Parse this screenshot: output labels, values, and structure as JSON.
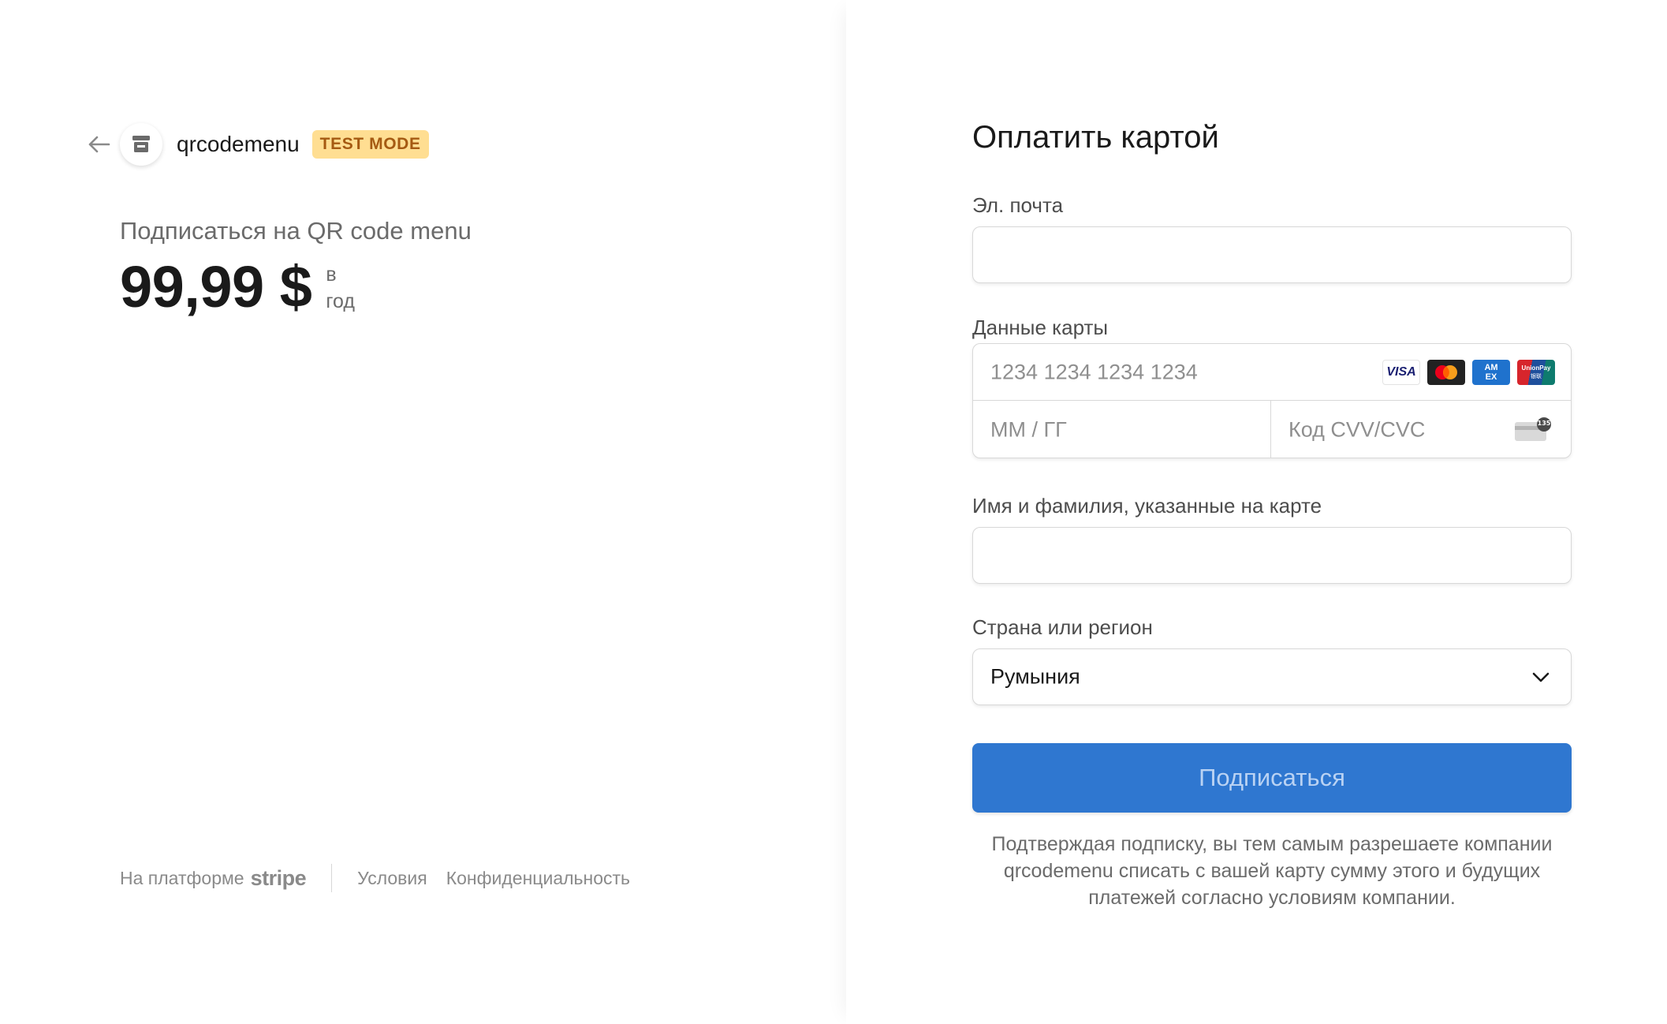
{
  "merchant": {
    "name": "qrcodemenu",
    "badge": "TEST MODE"
  },
  "product": {
    "name": "Подписаться на QR code menu",
    "price": "99,99 $",
    "interval_line1": "в",
    "interval_line2": "год"
  },
  "footer": {
    "powered_by": "На платформе",
    "stripe": "stripe",
    "terms": "Условия",
    "privacy": "Конфиденциальность"
  },
  "form": {
    "title": "Оплатить картой",
    "email_label": "Эл. почта",
    "email_value": "",
    "card_label": "Данные карты",
    "card_number_placeholder": "1234 1234 1234 1234",
    "expiry_placeholder": "ММ / ГГ",
    "cvc_placeholder": "Код CVV/CVC",
    "name_label": "Имя и фамилия, указанные на карте",
    "name_value": "",
    "country_label": "Страна или регион",
    "country_value": "Румыния",
    "submit_label": "Подписаться",
    "disclaimer": "Подтверждая подписку, вы тем самым разрешаете компании qrcodemenu списать с вашей карту сумму этого и будущих платежей согласно условиям компании."
  },
  "brands": {
    "visa": "VISA",
    "amex_top": "AM",
    "amex_bottom": "EX",
    "unionpay": "UnionPay",
    "unionpay_cn": "银联",
    "cvc_digits": "135"
  },
  "icons": [
    "arrow-left-icon",
    "store-icon",
    "chevron-down-icon",
    "visa-icon",
    "mastercard-icon",
    "amex-icon",
    "unionpay-icon",
    "cvc-card-icon"
  ],
  "colors": {
    "accent": "#2f77d0",
    "badge_bg": "#ffde92",
    "badge_text": "#a55a12"
  }
}
